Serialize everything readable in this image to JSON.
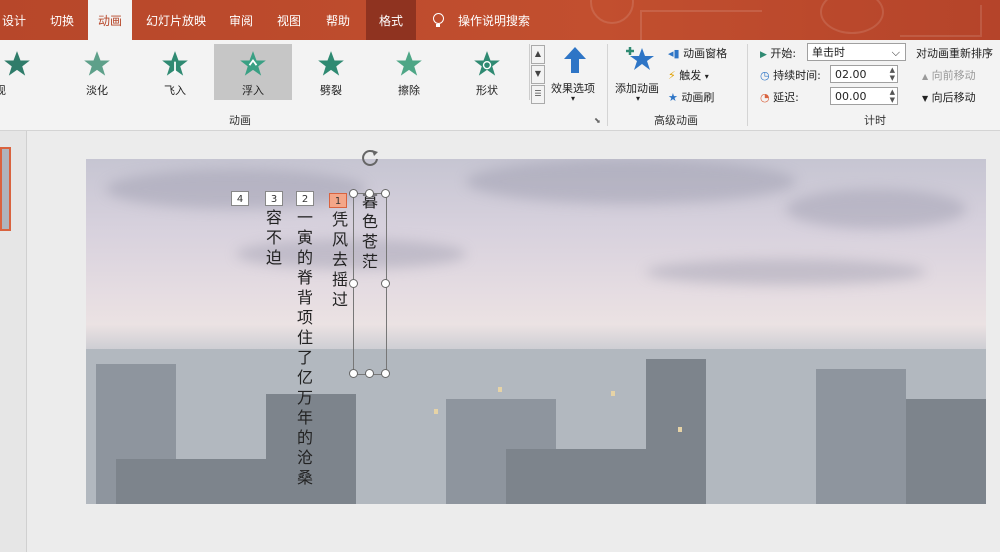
{
  "tabs": [
    "设计",
    "切换",
    "动画",
    "幻灯片放映",
    "审阅",
    "视图",
    "帮助",
    "格式",
    "操作说明搜索"
  ],
  "gallery": {
    "items": [
      {
        "label": "出现",
        "color": "#2f7c6a"
      },
      {
        "label": "淡化",
        "color": "#5ea08a"
      },
      {
        "label": "飞入",
        "color": "#2f8a72"
      },
      {
        "label": "浮入",
        "color": "#3aa084"
      },
      {
        "label": "劈裂",
        "color": "#2f8a72"
      },
      {
        "label": "擦除",
        "color": "#4ea686"
      },
      {
        "label": "形状",
        "color": "#2f8a72"
      }
    ],
    "selected": "浮入",
    "group_label": "动画"
  },
  "effect_options": "效果选项",
  "advanced": {
    "add_animation": "添加动画",
    "pane": "动画窗格",
    "trigger": "触发",
    "painter": "动画刷",
    "group_label": "高级动画"
  },
  "timing": {
    "start_label": "开始:",
    "start_value": "单击时",
    "duration_label": "持续时间:",
    "duration_value": "02.00",
    "delay_label": "延迟:",
    "delay_value": "00.00",
    "reorder_title": "对动画重新排序",
    "move_earlier": "向前移动",
    "move_later": "向后移动",
    "group_label": "计时"
  },
  "slide": {
    "tags": [
      "4",
      "3",
      "2",
      "1"
    ],
    "col1": "暮色苍茫",
    "col2": "凭风去摇过",
    "col3": "一寅的脊背项住了亿万年的沧桑",
    "col4": "容不迫"
  },
  "colors": {
    "ribbon": "#b7472a",
    "accent": "#d9633f"
  }
}
